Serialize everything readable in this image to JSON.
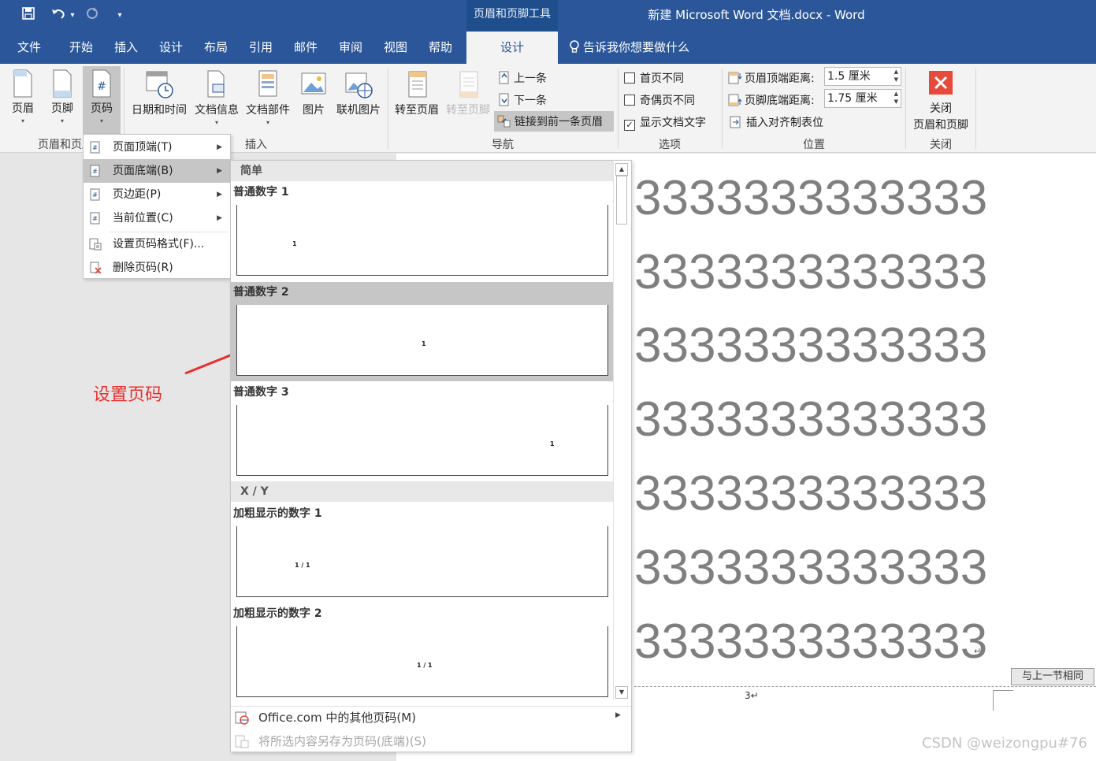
{
  "titlebar": {
    "context_tool": "页眉和页脚工具",
    "document_title": "新建 Microsoft Word 文档.docx  -  Word",
    "quick_access": {
      "save_icon": "save-icon",
      "undo_icon": "undo-icon",
      "undo_dropdown": "▾",
      "redo_icon": "redo-icon",
      "customize": "▾"
    }
  },
  "tabs": [
    {
      "label": "文件"
    },
    {
      "label": "开始"
    },
    {
      "label": "插入"
    },
    {
      "label": "设计"
    },
    {
      "label": "布局"
    },
    {
      "label": "引用"
    },
    {
      "label": "邮件"
    },
    {
      "label": "审阅"
    },
    {
      "label": "视图"
    },
    {
      "label": "帮助"
    },
    {
      "label": "设计",
      "active": true
    }
  ],
  "tell_me": "告诉我你想要做什么",
  "ribbon": {
    "header_footer_group": {
      "header": "页眉",
      "footer": "页脚",
      "page_number": "页码",
      "group_label": "页眉和页脚"
    },
    "insert_group": {
      "date_time": "日期和时间",
      "doc_info": "文档信息",
      "doc_parts": "文档部件",
      "picture": "图片",
      "online_picture": "联机图片",
      "group_label": "插入"
    },
    "nav_group": {
      "goto_header": "转至页眉",
      "goto_footer": "转至页脚",
      "previous": "上一条",
      "next": "下一条",
      "link_previous": "链接到前一条页眉",
      "group_label": "导航"
    },
    "options_group": {
      "diff_first": "首页不同",
      "diff_odd_even": "奇偶页不同",
      "show_doc_text": "显示文档文字",
      "group_label": "选项",
      "show_doc_text_checked": true
    },
    "position_group": {
      "header_top_label": "页眉顶端距离:",
      "header_top_value": "1.5 厘米",
      "footer_bottom_label": "页脚底端距离:",
      "footer_bottom_value": "1.75 厘米",
      "insert_align_tab": "插入对齐制表位",
      "group_label": "位置"
    },
    "close_group": {
      "close_line1": "关闭",
      "close_line2": "页眉和页脚",
      "group_label": "关闭"
    }
  },
  "page_number_menu": {
    "items": [
      {
        "label": "页面顶端(T)"
      },
      {
        "label": "页面底端(B)",
        "highlighted": true
      },
      {
        "label": "页边距(P)"
      },
      {
        "label": "当前位置(C)"
      },
      {
        "label": "设置页码格式(F)..."
      },
      {
        "label": "删除页码(R)"
      }
    ]
  },
  "gallery": {
    "sections": [
      {
        "label": "简单"
      },
      {
        "label": "X / Y"
      }
    ],
    "items": [
      {
        "title": "普通数字 1",
        "preview": "1"
      },
      {
        "title": "普通数字 2",
        "preview": "1",
        "highlighted": true
      },
      {
        "title": "普通数字 3",
        "preview": "1"
      },
      {
        "title": "加粗显示的数字 1",
        "preview": "1 / 1"
      },
      {
        "title": "加粗显示的数字 2",
        "preview": "1 / 1"
      }
    ],
    "more_from_office": "Office.com 中的其他页码(M)",
    "save_selection": "将所选内容另存为页码(底端)(S)"
  },
  "document": {
    "lines": [
      "3333333333333",
      "3333333333333",
      "3333333333333",
      "3333333333333",
      "3333333333333",
      "3333333333333",
      "3333333333333"
    ],
    "paragraph_mark": "↵",
    "same_as_previous": "与上一节相同",
    "footer_page_number": "3↵"
  },
  "annotation": {
    "label": "设置页码",
    "color": "#e8302e"
  },
  "watermark": "CSDN @weizongpu#76",
  "colors": {
    "brand": "#2b579a",
    "ribbon_bg": "#f3f3f3",
    "highlight": "#c6c6c6",
    "close_red": "#e64a3b"
  }
}
